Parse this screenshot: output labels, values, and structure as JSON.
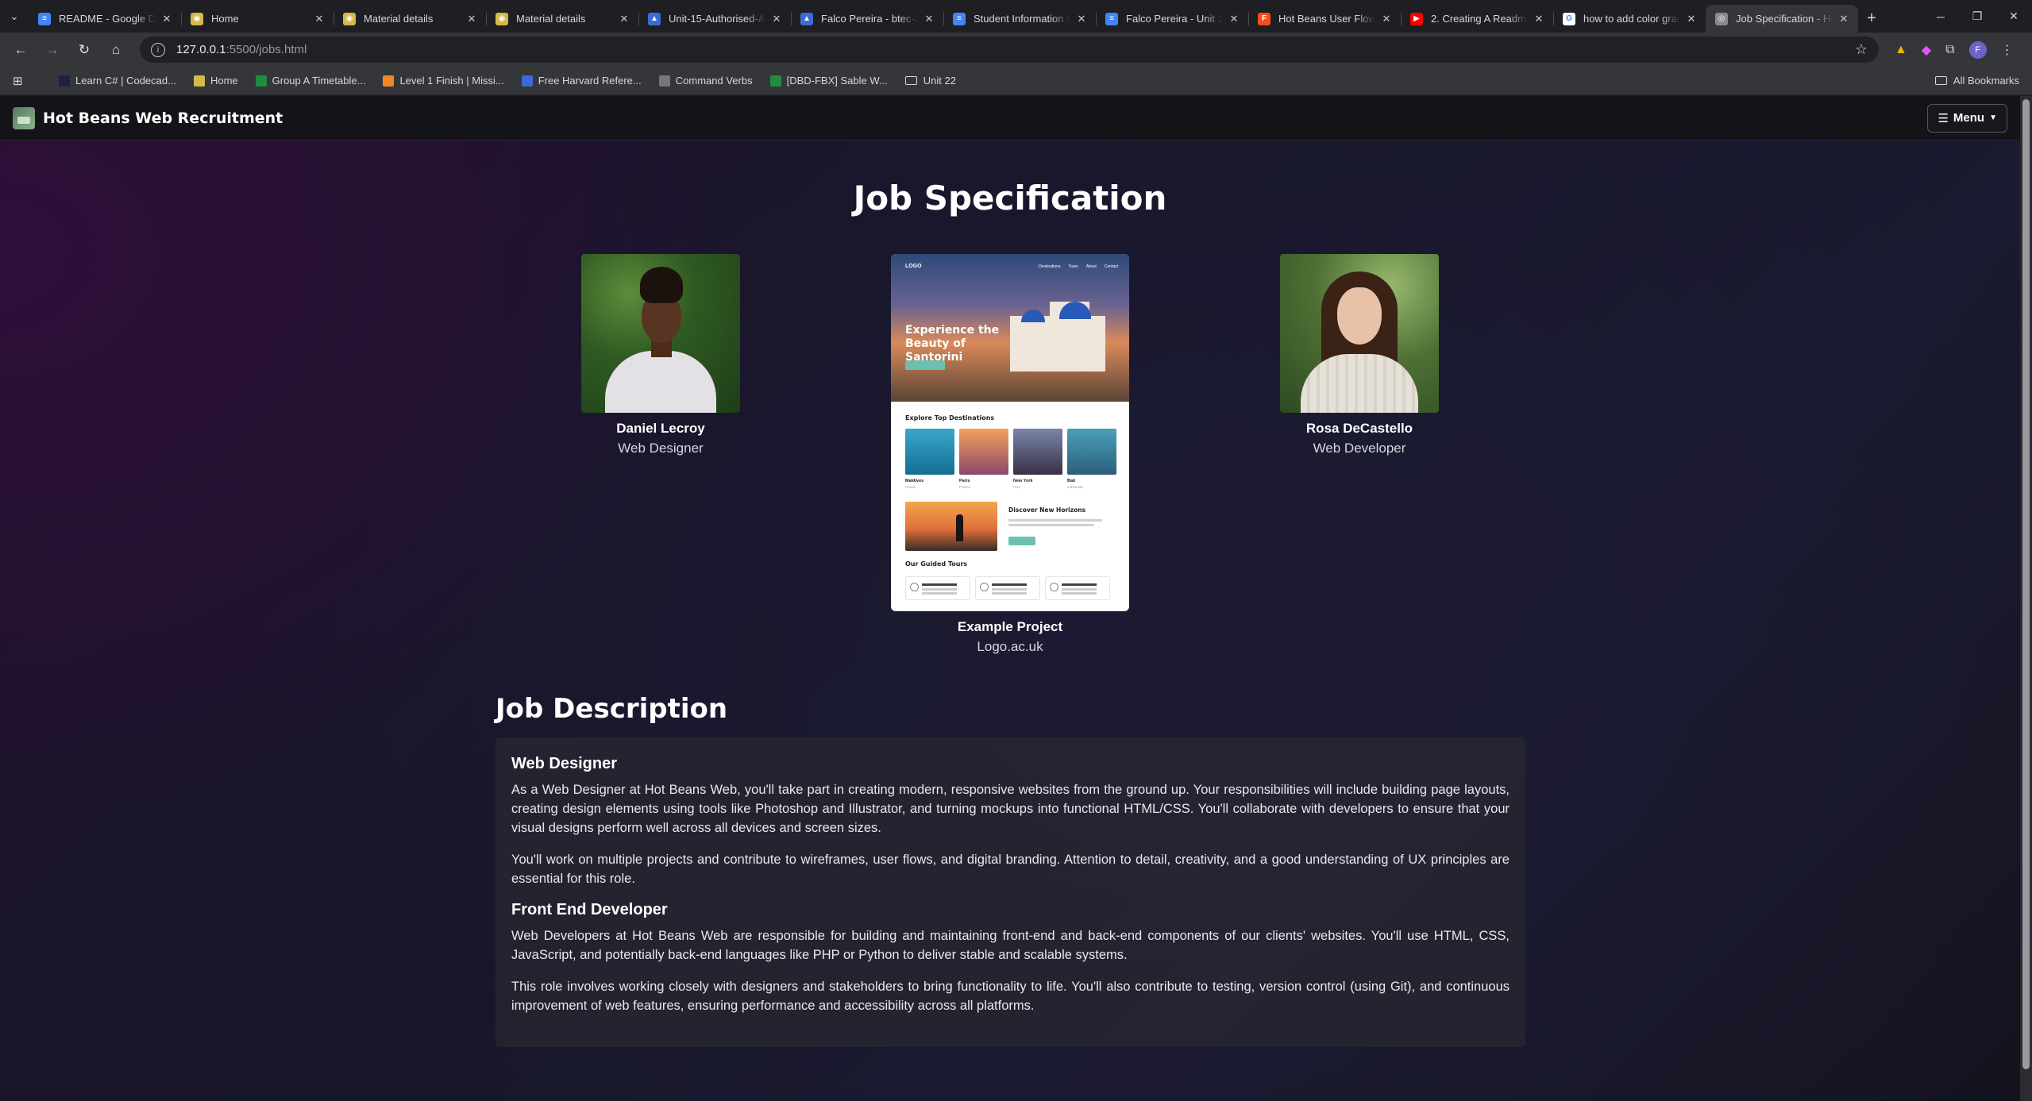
{
  "browser": {
    "tabs": [
      {
        "title": "README - Google Docs",
        "fav": "#4285f4",
        "glyph": "≡"
      },
      {
        "title": "Home",
        "fav": "#d6b94a",
        "glyph": "◉"
      },
      {
        "title": "Material details",
        "fav": "#d6b94a",
        "glyph": "◉"
      },
      {
        "title": "Material details",
        "fav": "#d6b94a",
        "glyph": "◉"
      },
      {
        "title": "Unit-15-Authorised-Assignment",
        "fav": "#3b6bd6",
        "glyph": "▲"
      },
      {
        "title": "Falco Pereira - btec-assignment",
        "fav": "#3b6bd6",
        "glyph": "▲"
      },
      {
        "title": "Student Information Sheet",
        "fav": "#4285f4",
        "glyph": "≡"
      },
      {
        "title": "Falco Pereira - Unit 15",
        "fav": "#4285f4",
        "glyph": "≡"
      },
      {
        "title": "Hot Beans User Flow - Figma",
        "fav": "#f24e1e",
        "glyph": "F"
      },
      {
        "title": "2. Creating A Readme",
        "fav": "#ff0000",
        "glyph": "▶"
      },
      {
        "title": "how to add color gradient",
        "fav": "#ffffff",
        "glyph": "G"
      },
      {
        "title": "Job Specification - Hot Beans",
        "fav": "#8a8a90",
        "glyph": "◎"
      }
    ],
    "active_tab": 11,
    "url_host": "127.0.0.1",
    "url_path": ":5500/jobs.html",
    "bookmarks": [
      {
        "label": "Learn C# | Codecad...",
        "color": "#1f1f44"
      },
      {
        "label": "Home",
        "color": "#d6b94a"
      },
      {
        "label": "Group A Timetable...",
        "color": "#1e8e3e"
      },
      {
        "label": "Level 1 Finish | Missi...",
        "color": "#f08a24"
      },
      {
        "label": "Free Harvard Refere...",
        "color": "#3b6bd6"
      },
      {
        "label": "Command Verbs",
        "color": "#777777"
      },
      {
        "label": "[DBD-FBX] Sable W...",
        "color": "#1e8e3e"
      },
      {
        "label": "Unit 22",
        "color": "folder"
      }
    ],
    "all_bookmarks": "All Bookmarks",
    "profile_initial": "F"
  },
  "site": {
    "brand": "Hot Beans Web Recruitment",
    "menu_label": "Menu",
    "page_title": "Job Specification",
    "cards": [
      {
        "name": "Daniel Lecroy",
        "role": "Web Designer"
      },
      {
        "name": "Example Project",
        "role": "Logo.ac.uk"
      },
      {
        "name": "Rosa DeCastello",
        "role": "Web Developer"
      }
    ],
    "mockup": {
      "logo": "LOGO",
      "links": [
        "Destinations",
        "Tours",
        "About",
        "Contact"
      ],
      "hero_title": "Experience the Beauty of Santorini",
      "section1": "Explore Top Destinations",
      "destinations": [
        {
          "name": "Maldives",
          "sub": "Ocean"
        },
        {
          "name": "Paris",
          "sub": "France"
        },
        {
          "name": "New York",
          "sub": "USA"
        },
        {
          "name": "Bali",
          "sub": "Indonesia"
        }
      ],
      "feature_title": "Discover New Horizons",
      "section2": "Our Guided Tours",
      "tours": [
        "Expert Guides",
        "Handpicked Hotels",
        "Flexible Itineraries"
      ]
    },
    "jd_title": "Job Description",
    "jobs": [
      {
        "title": "Web Designer",
        "paragraphs": [
          "As a Web Designer at Hot Beans Web, you'll take part in creating modern, responsive websites from the ground up. Your responsibilities will include building page layouts, creating design elements using tools like Photoshop and Illustrator, and turning mockups into functional HTML/CSS. You'll collaborate with developers to ensure that your visual designs perform well across all devices and screen sizes.",
          "You'll work on multiple projects and contribute to wireframes, user flows, and digital branding. Attention to detail, creativity, and a good understanding of UX principles are essential for this role."
        ]
      },
      {
        "title": "Front End Developer",
        "paragraphs": [
          "Web Developers at Hot Beans Web are responsible for building and maintaining front-end and back-end components of our clients' websites. You'll use HTML, CSS, JavaScript, and potentially back-end languages like PHP or Python to deliver stable and scalable systems.",
          "This role involves working closely with designers and stakeholders to bring functionality to life. You'll also contribute to testing, version control (using Git), and continuous improvement of web features, ensuring performance and accessibility across all platforms."
        ]
      }
    ]
  }
}
